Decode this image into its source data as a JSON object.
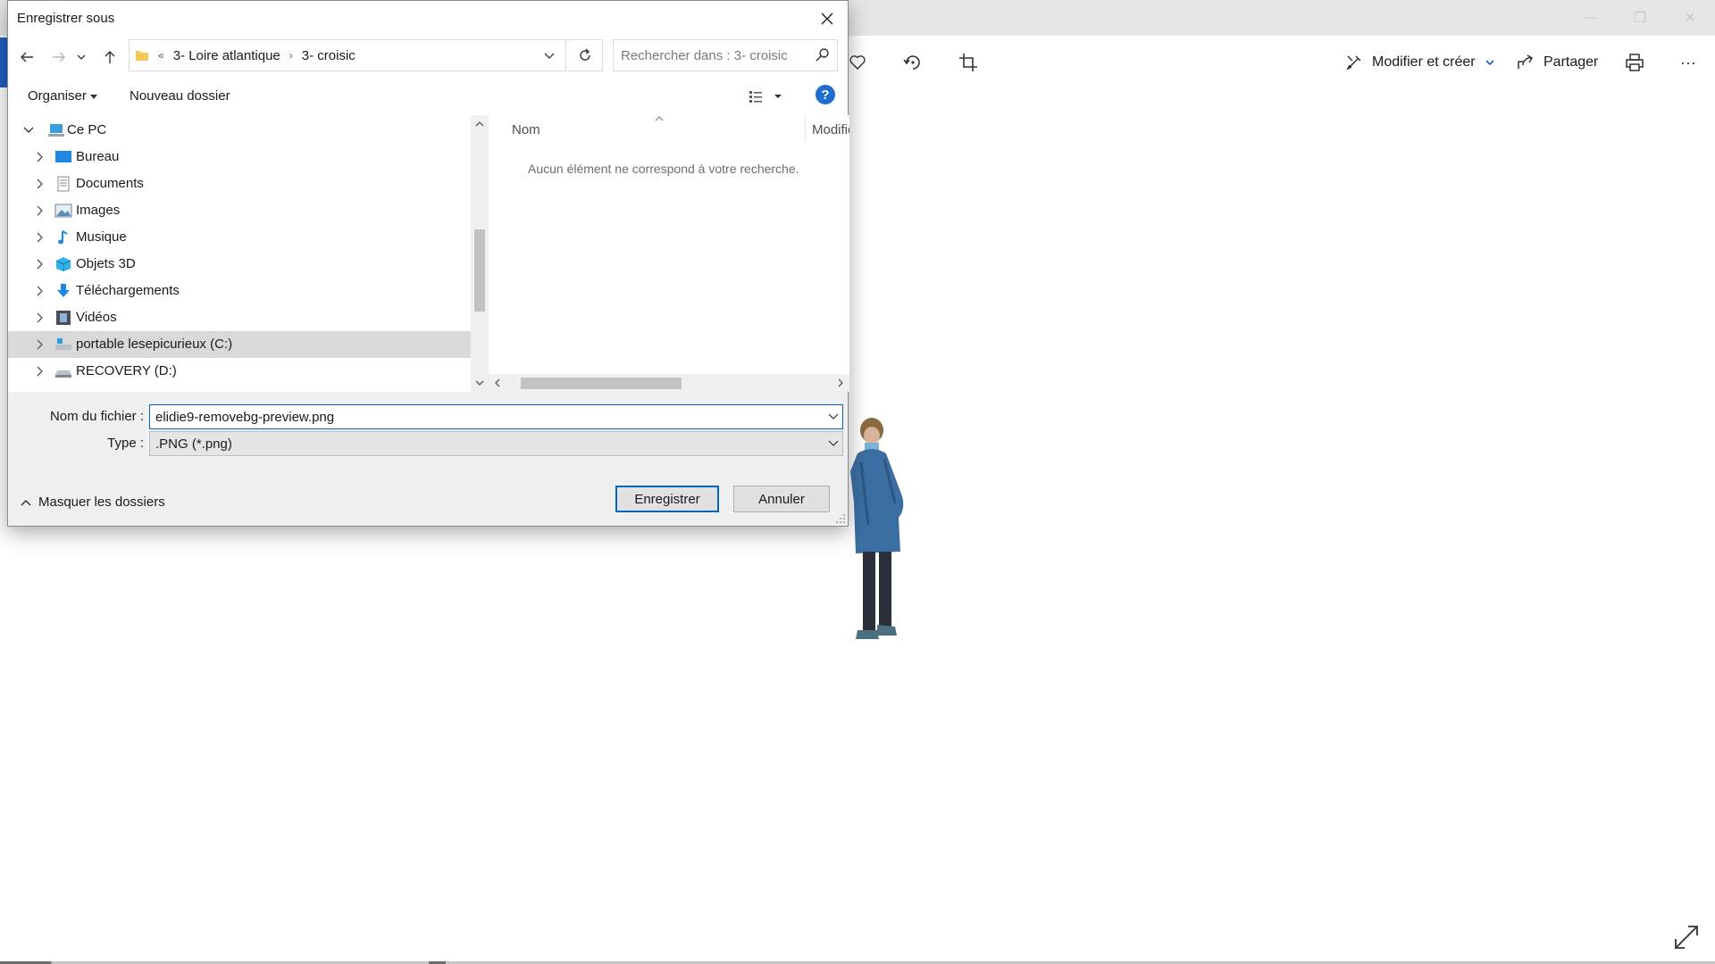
{
  "dialog": {
    "title": "Enregistrer sous",
    "breadcrumb": {
      "overflow": "«",
      "segments": [
        "3- Loire atlantique",
        "3- croisic"
      ]
    },
    "search": {
      "placeholder": "Rechercher dans : 3- croisic"
    },
    "commands": {
      "organize": "Organiser",
      "new_folder": "Nouveau dossier"
    },
    "help_label": "?",
    "tree": [
      {
        "label": "Ce PC",
        "icon": "computer-icon",
        "expanded": true
      },
      {
        "label": "Bureau",
        "icon": "desktop-icon"
      },
      {
        "label": "Documents",
        "icon": "documents-icon"
      },
      {
        "label": "Images",
        "icon": "pictures-icon"
      },
      {
        "label": "Musique",
        "icon": "music-icon"
      },
      {
        "label": "Objets 3D",
        "icon": "3d-objects-icon"
      },
      {
        "label": "Téléchargements",
        "icon": "downloads-icon"
      },
      {
        "label": "Vidéos",
        "icon": "videos-icon"
      },
      {
        "label": "portable lesepicurieux (C:)",
        "icon": "drive-c-icon",
        "selected": true
      },
      {
        "label": "RECOVERY (D:)",
        "icon": "drive-d-icon"
      }
    ],
    "file_list": {
      "columns": [
        "Nom",
        "Modifié"
      ],
      "empty_message": "Aucun élément ne correspond à votre recherche."
    },
    "filename": {
      "label": "Nom du fichier :",
      "value": "elidie9-removebg-preview.png"
    },
    "filetype": {
      "label": "Type :",
      "value": ".PNG (*.png)"
    },
    "hide_folders": "Masquer les dossiers",
    "buttons": {
      "save": "Enregistrer",
      "cancel": "Annuler"
    }
  },
  "photos_app": {
    "edit_create": "Modifier et créer",
    "share": "Partager",
    "more": "···",
    "accent_color": "#1f5fbf"
  }
}
